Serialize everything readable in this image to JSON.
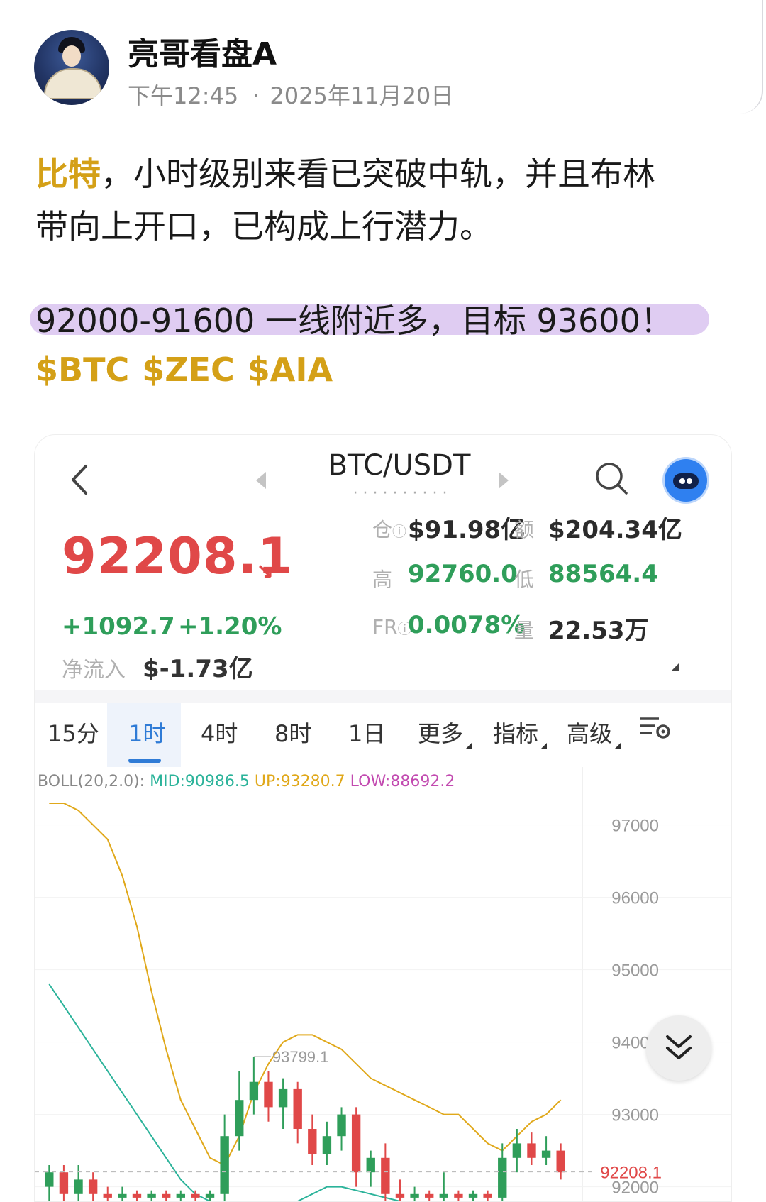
{
  "post": {
    "username": "亮哥看盘A",
    "time": "下午12:45",
    "date": "2025年11月20日",
    "body_highlight": "比特",
    "body_line1_rest": "，小时级别来看已突破中轨，并且布林",
    "body_line2": "带向上开口，已构成上行潜力。",
    "trade_line": "92000-91600 一线附近多，目标 93600！",
    "tickers": [
      "$BTC",
      "$ZEC",
      "$AIA"
    ]
  },
  "card": {
    "pair_title": "BTC/USDT",
    "price": "92208.1",
    "price_arrow": "↘",
    "change_abs": "+1092.7",
    "change_pct": "+1.20%",
    "netflow_label": "净流入",
    "netflow_value": "$-1.73亿",
    "stats": {
      "oi_label": "仓",
      "oi_value": "$91.98亿",
      "amount_label": "额",
      "amount_value": "$204.34亿",
      "high_label": "高",
      "high_value": "92760.0",
      "low_label": "低",
      "low_value": "88564.4",
      "fr_label": "FR",
      "fr_value": "0.0078%",
      "vol_label": "量",
      "vol_value": "22.53万"
    },
    "tabs": [
      "15分",
      "1时",
      "4时",
      "8时",
      "1日",
      "更多",
      "指标",
      "高级"
    ],
    "active_tab": "1时",
    "boll": {
      "prefix": "BOLL(20,2.0):",
      "mid": "MID:90986.5",
      "up": "UP:93280.7",
      "low": "LOW:88692.2"
    }
  },
  "chart_data": {
    "type": "candlestick",
    "y_ticks": [
      "97000",
      "96000",
      "95000",
      "94000",
      "93000",
      "92000"
    ],
    "ylim": [
      91800,
      97800
    ],
    "last_price": "92208.1",
    "high_marker": "93799.1",
    "indicator": "BOLL(20,2.0)",
    "series": [
      {
        "name": "UP",
        "color": "#e0a81a",
        "values": [
          97300,
          97300,
          97200,
          97000,
          96800,
          96300,
          95600,
          94700,
          93900,
          93200,
          92800,
          92400,
          92300,
          92700,
          93300,
          93700,
          94000,
          94100,
          94100,
          94000,
          93900,
          93700,
          93500,
          93400,
          93300,
          93200,
          93100,
          93000,
          93000,
          92800,
          92600,
          92500,
          92700,
          92900,
          93000,
          93200
        ]
      },
      {
        "name": "LOW",
        "color": "#2bb39a",
        "values": [
          94800,
          94500,
          94200,
          93900,
          93600,
          93300,
          93000,
          92700,
          92400,
          92100,
          91900,
          91800,
          91800,
          91800,
          91800,
          91800,
          91800,
          91800,
          91900,
          92000,
          92000,
          91950,
          91900,
          91850,
          91800,
          91800,
          91800,
          91800,
          91800,
          91800,
          91800,
          91800,
          91800,
          91800,
          91800,
          91800
        ]
      }
    ],
    "candles": [
      {
        "o": 92000,
        "c": 92200,
        "h": 92300,
        "l": 91800
      },
      {
        "o": 92200,
        "c": 91900,
        "h": 92300,
        "l": 91800
      },
      {
        "o": 91900,
        "c": 92100,
        "h": 92300,
        "l": 91800
      },
      {
        "o": 92100,
        "c": 91900,
        "h": 92200,
        "l": 91800
      },
      {
        "o": 91900,
        "c": 91850,
        "h": 92000,
        "l": 91800
      },
      {
        "o": 91850,
        "c": 91900,
        "h": 92000,
        "l": 91800
      },
      {
        "o": 91900,
        "c": 91850,
        "h": 91950,
        "l": 91800
      },
      {
        "o": 91850,
        "c": 91900,
        "h": 91950,
        "l": 91800
      },
      {
        "o": 91900,
        "c": 91850,
        "h": 91950,
        "l": 91800
      },
      {
        "o": 91850,
        "c": 91900,
        "h": 91950,
        "l": 91800
      },
      {
        "o": 91900,
        "c": 91850,
        "h": 91950,
        "l": 91800
      },
      {
        "o": 91850,
        "c": 91900,
        "h": 91950,
        "l": 91800
      },
      {
        "o": 91900,
        "c": 92700,
        "h": 93000,
        "l": 91800
      },
      {
        "o": 92700,
        "c": 93200,
        "h": 93600,
        "l": 92500
      },
      {
        "o": 93200,
        "c": 93450,
        "h": 93800,
        "l": 93000
      },
      {
        "o": 93450,
        "c": 93100,
        "h": 93600,
        "l": 92900
      },
      {
        "o": 93100,
        "c": 93350,
        "h": 93500,
        "l": 92800
      },
      {
        "o": 93350,
        "c": 92800,
        "h": 93450,
        "l": 92600
      },
      {
        "o": 92800,
        "c": 92450,
        "h": 93000,
        "l": 92300
      },
      {
        "o": 92450,
        "c": 92700,
        "h": 92900,
        "l": 92300
      },
      {
        "o": 92700,
        "c": 93000,
        "h": 93100,
        "l": 92500
      },
      {
        "o": 93000,
        "c": 92200,
        "h": 93100,
        "l": 92000
      },
      {
        "o": 92200,
        "c": 92400,
        "h": 92500,
        "l": 92000
      },
      {
        "o": 92400,
        "c": 91900,
        "h": 92600,
        "l": 91800
      },
      {
        "o": 91900,
        "c": 91850,
        "h": 92100,
        "l": 91800
      },
      {
        "o": 91850,
        "c": 91900,
        "h": 92000,
        "l": 91800
      },
      {
        "o": 91900,
        "c": 91850,
        "h": 91950,
        "l": 91800
      },
      {
        "o": 91850,
        "c": 91900,
        "h": 92200,
        "l": 91800
      },
      {
        "o": 91900,
        "c": 91850,
        "h": 91950,
        "l": 91800
      },
      {
        "o": 91850,
        "c": 91900,
        "h": 91950,
        "l": 91800
      },
      {
        "o": 91900,
        "c": 91850,
        "h": 91950,
        "l": 91800
      },
      {
        "o": 91850,
        "c": 92400,
        "h": 92600,
        "l": 91800
      },
      {
        "o": 92400,
        "c": 92600,
        "h": 92800,
        "l": 92200
      },
      {
        "o": 92600,
        "c": 92400,
        "h": 92750,
        "l": 92300
      },
      {
        "o": 92400,
        "c": 92500,
        "h": 92700,
        "l": 92300
      },
      {
        "o": 92500,
        "c": 92200,
        "h": 92600,
        "l": 92100
      }
    ]
  }
}
